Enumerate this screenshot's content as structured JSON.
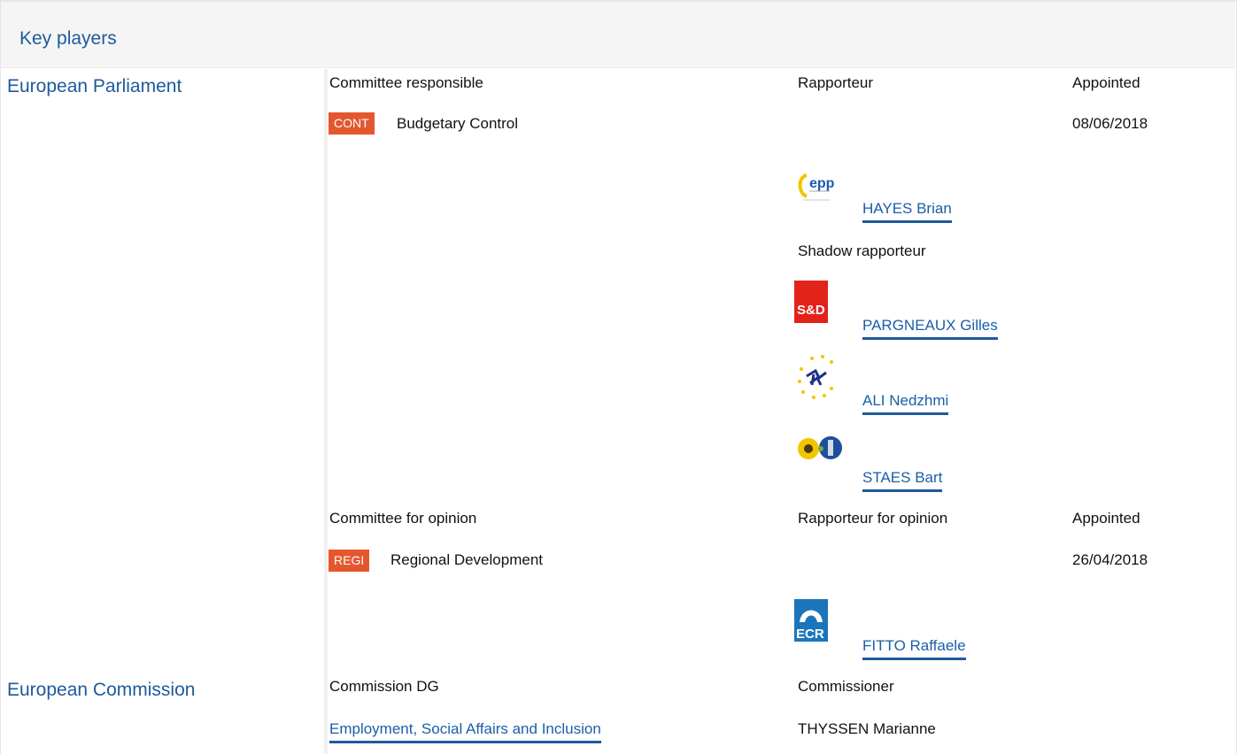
{
  "header": {
    "title": "Key players"
  },
  "parliament": {
    "label": "European Parliament",
    "committee_header": "Committee responsible",
    "rapporteur_header": "Rapporteur",
    "appointed_header": "Appointed",
    "committee": {
      "code": "CONT",
      "name": "Budgetary Control",
      "appointed": "08/06/2018"
    },
    "rapporteur": {
      "name": "HAYES Brian",
      "group_logo": "epp-logo"
    },
    "shadow_label": "Shadow rapporteur",
    "shadows": [
      {
        "name": "PARGNEAUX Gilles",
        "group_logo": "sd-logo"
      },
      {
        "name": "ALI Nedzhmi",
        "group_logo": "alde-logo"
      },
      {
        "name": "STAES Bart",
        "group_logo": "greens-efa-logo"
      }
    ],
    "opinion": {
      "committee_header": "Committee for opinion",
      "rapporteur_header": "Rapporteur for opinion",
      "appointed_header": "Appointed",
      "code": "REGI",
      "name": "Regional Development",
      "appointed": "26/04/2018",
      "rapporteur": {
        "name": "FITTO Raffaele",
        "group_logo": "ecr-logo"
      }
    }
  },
  "commission": {
    "label": "European Commission",
    "dg_header": "Commission DG",
    "commissioner_header": "Commissioner",
    "dg": "Employment, Social Affairs and Inclusion",
    "commissioner": "THYSSEN Marianne"
  },
  "logo_text": {
    "epp": "epp",
    "sd": "S&D",
    "ecr": "ECR"
  },
  "colors": {
    "accent": "#1e5a9c",
    "badge": "#e4572e",
    "header_bg": "#f5f5f5",
    "sd_red": "#e2231a",
    "ecr_blue": "#1b75bb"
  }
}
